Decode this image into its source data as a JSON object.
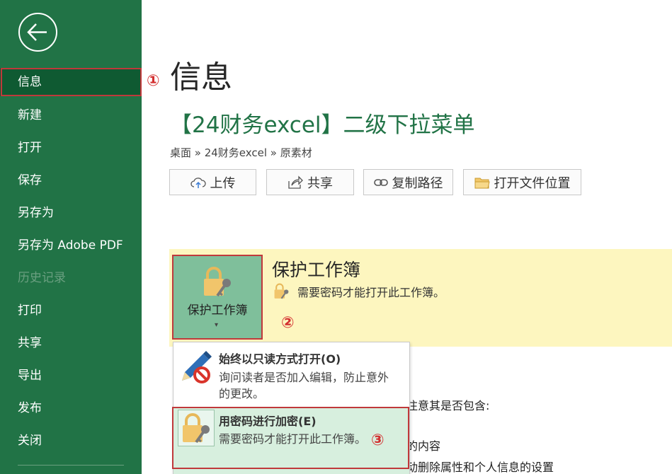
{
  "sidebar": {
    "items": [
      {
        "label": "信息",
        "state": "selected"
      },
      {
        "label": "新建"
      },
      {
        "label": "打开"
      },
      {
        "label": "保存"
      },
      {
        "label": "另存为"
      },
      {
        "label": "另存为 Adobe PDF"
      },
      {
        "label": "历史记录",
        "state": "disabled"
      },
      {
        "label": "打印"
      },
      {
        "label": "共享"
      },
      {
        "label": "导出"
      },
      {
        "label": "发布"
      },
      {
        "label": "关闭"
      }
    ]
  },
  "markers": {
    "one": "①",
    "two": "②",
    "three": "③"
  },
  "main": {
    "page_title": "信息",
    "doc_title": "【24财务excel】二级下拉菜单",
    "breadcrumb": "桌面 » 24财务excel » 原素材",
    "buttons": {
      "upload": "上传",
      "share": "共享",
      "copy_path": "复制路径",
      "open_location": "打开文件位置"
    }
  },
  "protect": {
    "button_label": "保护工作簿",
    "caret": "▾",
    "title": "保护工作簿",
    "desc": "需要密码才能打开此工作簿。"
  },
  "background_text": {
    "line1": "注意其是否包含:",
    "line2": "的内容",
    "line3": "动删除属性和个人信息的设置"
  },
  "dropdown": {
    "readonly": {
      "title": "始终以只读方式打开(O)",
      "desc": "询问读者是否加入编辑，防止意外的更改。"
    },
    "encrypt": {
      "title": "用密码进行加密(E)",
      "desc": "需要密码才能打开此工作簿。"
    }
  },
  "colors": {
    "sidebar": "#217346",
    "sidebar_selected": "#0f5a32",
    "accent_green": "#217346",
    "protect_bg": "#fdf6bf",
    "protect_button": "#7fbf9b",
    "highlight_red": "#c0393b"
  }
}
